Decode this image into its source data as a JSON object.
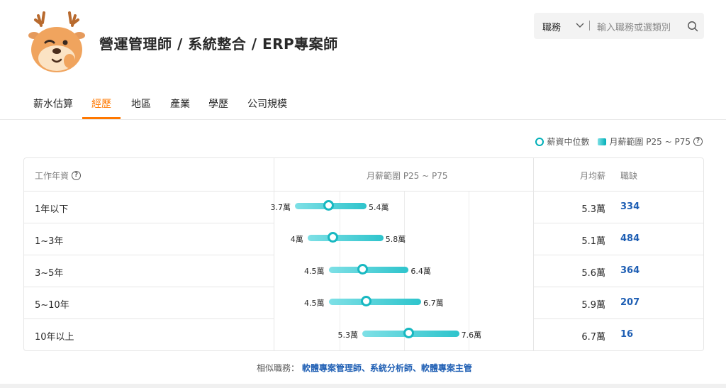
{
  "header": {
    "job_title": "營運管理師 / 系統整合 / ERP專案師"
  },
  "search": {
    "category": "職務",
    "placeholder": "輸入職務或選類別"
  },
  "tabs": [
    {
      "label": "薪水估算",
      "active": false
    },
    {
      "label": "經歷",
      "active": true
    },
    {
      "label": "地區",
      "active": false
    },
    {
      "label": "產業",
      "active": false
    },
    {
      "label": "學歷",
      "active": false
    },
    {
      "label": "公司規模",
      "active": false
    }
  ],
  "legend": {
    "median_label": "薪資中位數",
    "range_label": "月薪範圍 P25 ~ P75"
  },
  "table": {
    "col_years": "工作年資",
    "col_range": "月薪範圍 P25 ~ P75",
    "col_avg": "月均薪",
    "col_openings": "職缺",
    "rows": [
      {
        "years": "1年以下",
        "p25_label": "3.7萬",
        "p75_label": "5.4萬",
        "p25": 3.7,
        "p75": 5.4,
        "median": 4.5,
        "avg": "5.3萬",
        "openings": "334"
      },
      {
        "years": "1~3年",
        "p25_label": "4萬",
        "p75_label": "5.8萬",
        "p25": 4.0,
        "p75": 5.8,
        "median": 4.6,
        "avg": "5.1萬",
        "openings": "484"
      },
      {
        "years": "3~5年",
        "p25_label": "4.5萬",
        "p75_label": "6.4萬",
        "p25": 4.5,
        "p75": 6.4,
        "median": 5.3,
        "avg": "5.6萬",
        "openings": "364"
      },
      {
        "years": "5~10年",
        "p25_label": "4.5萬",
        "p75_label": "6.7萬",
        "p25": 4.5,
        "p75": 6.7,
        "median": 5.4,
        "avg": "5.9萬",
        "openings": "207"
      },
      {
        "years": "10年以上",
        "p25_label": "5.3萬",
        "p75_label": "7.6萬",
        "p25": 5.3,
        "p75": 7.6,
        "median": 6.4,
        "avg": "6.7萬",
        "openings": "16"
      }
    ]
  },
  "similar": {
    "prefix": "相似職務：",
    "links": "軟體專案管理師、系統分析師、軟體專案主管"
  },
  "colors": {
    "accent": "#ff7800",
    "teal": "#00afb8",
    "link": "#1f5fb4"
  }
}
